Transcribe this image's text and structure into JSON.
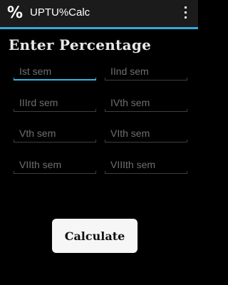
{
  "app": {
    "title": "UPTU%Calc",
    "icon": "percent-icon",
    "accent_color": "#34aadc"
  },
  "main": {
    "heading": "Enter Percentage",
    "fields": [
      {
        "placeholder": "Ist sem",
        "value": ""
      },
      {
        "placeholder": "IInd sem",
        "value": ""
      },
      {
        "placeholder": "IIIrd sem",
        "value": ""
      },
      {
        "placeholder": "IVth sem",
        "value": ""
      },
      {
        "placeholder": "Vth sem",
        "value": ""
      },
      {
        "placeholder": "VIth sem",
        "value": ""
      },
      {
        "placeholder": "VIIth sem",
        "value": ""
      },
      {
        "placeholder": "VIIIth sem",
        "value": ""
      }
    ],
    "button_label": "Calculate"
  }
}
